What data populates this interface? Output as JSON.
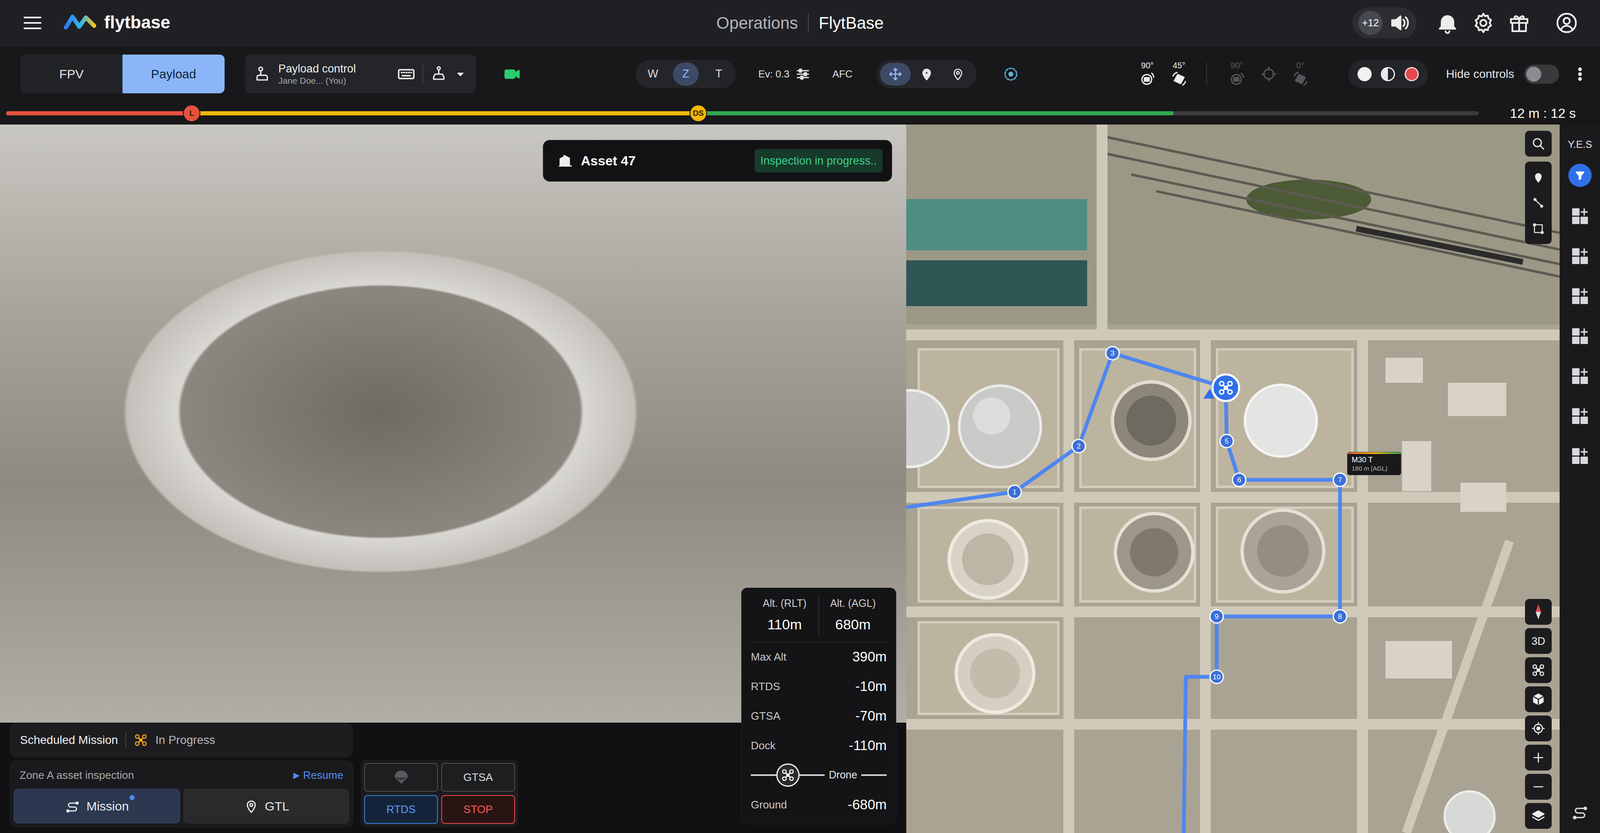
{
  "header": {
    "logo": "flytbase",
    "title": "Operations",
    "org": "FlytBase",
    "badge": "+12"
  },
  "view_tabs": [
    {
      "label": "FPV",
      "selected": false
    },
    {
      "label": "Payload",
      "selected": true
    }
  ],
  "payload_control": {
    "title": "Payload control",
    "user": "Jane Doe... (You)"
  },
  "zoom": [
    {
      "label": "W",
      "selected": false
    },
    {
      "label": "Z",
      "selected": true
    },
    {
      "label": "T",
      "selected": false
    }
  ],
  "exposure": "Ev: 0.3",
  "focus": "AFC",
  "modes": [
    {
      "kind": "move",
      "selected": true
    },
    {
      "kind": "pin",
      "selected": false
    },
    {
      "kind": "poi",
      "selected": false
    }
  ],
  "gimbal": [
    {
      "label": "90°",
      "kind": "pitch",
      "disabled": false
    },
    {
      "label": "45°",
      "kind": "yaw",
      "disabled": false
    },
    {
      "label": "90°",
      "kind": "pitch",
      "disabled": true
    },
    {
      "kind": "center",
      "disabled": true
    },
    {
      "label": "0°",
      "kind": "yaw",
      "disabled": true
    }
  ],
  "capture": [
    {
      "kind": "photo"
    },
    {
      "kind": "mode"
    },
    {
      "kind": "record"
    }
  ],
  "hide_controls": {
    "label": "Hide controls",
    "on": false
  },
  "timeline": {
    "segments": [
      {
        "marker": "L",
        "level": 0.126,
        "color": "#e8513f"
      },
      {
        "marker": "DS",
        "level": 0.47,
        "color": "#f2b705"
      },
      {
        "level": 0.793,
        "color": "#2ea84f"
      }
    ],
    "time": "12 m : 12 s"
  },
  "asset": {
    "name": "Asset 47",
    "status": "Inspection in progress.."
  },
  "mission": {
    "title": "Scheduled Mission",
    "status": "In Progress",
    "name": "Zone A asset inspection",
    "resume_icon": "▶",
    "resume": "Resume",
    "buttons": [
      {
        "label": "Mission",
        "kind": "route",
        "selected": true,
        "notify": true
      },
      {
        "label": "GTL",
        "kind": "pin",
        "selected": false,
        "notify": false
      }
    ]
  },
  "actions": [
    {
      "label": "GTSA",
      "kind": "neutral"
    },
    {
      "label": "RTDS",
      "kind": "primary"
    },
    {
      "label": "STOP",
      "kind": "danger"
    }
  ],
  "altitude": {
    "summary": [
      {
        "label": "Alt. (RLT)",
        "value": "110m"
      },
      {
        "label": "Alt. (AGL)",
        "value": "680m"
      }
    ],
    "rows": [
      {
        "kind": "value",
        "label": "Max Alt",
        "value": "390m"
      },
      {
        "kind": "value",
        "label": "RTDS",
        "value": "-10m"
      },
      {
        "kind": "value",
        "label": "GTSA",
        "value": "-70m"
      },
      {
        "kind": "value",
        "label": "Dock",
        "value": "-110m"
      },
      {
        "kind": "drone",
        "label": "Drone"
      },
      {
        "kind": "value",
        "label": "Ground",
        "value": "-680m"
      }
    ]
  },
  "map": {
    "waypoints": [
      "1",
      "2",
      "3",
      "5",
      "6",
      "7",
      "8",
      "9",
      "10"
    ],
    "drone": {
      "model": "M30 T",
      "altitude": "180 m (AGL)"
    },
    "view_3d": "3D"
  },
  "sidebar": {
    "label": "Y.E.S",
    "filter_active": true
  }
}
